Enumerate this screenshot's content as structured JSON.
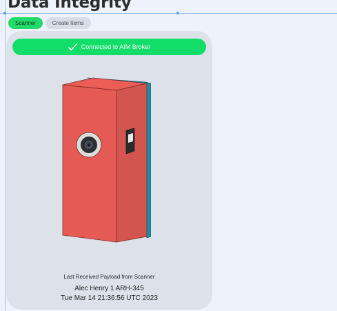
{
  "page": {
    "title": "Data Integrity"
  },
  "tabs": [
    {
      "label": "Scanner",
      "active": true
    },
    {
      "label": "Create Items",
      "active": false
    }
  ],
  "status": {
    "text": "Connected to AIM Broker",
    "icon": "checkmark-icon",
    "color": "#12dd68"
  },
  "scanner": {
    "image": "barcode-scanner-device",
    "body_color": "#e65a55",
    "side_color": "#1a8fa3"
  },
  "payload": {
    "label": "Last Received Payload from Scanner",
    "value": "Alec Henry 1 ARH-345",
    "timestamp": "Tue Mar 14 21:36:56 UTC 2023"
  }
}
